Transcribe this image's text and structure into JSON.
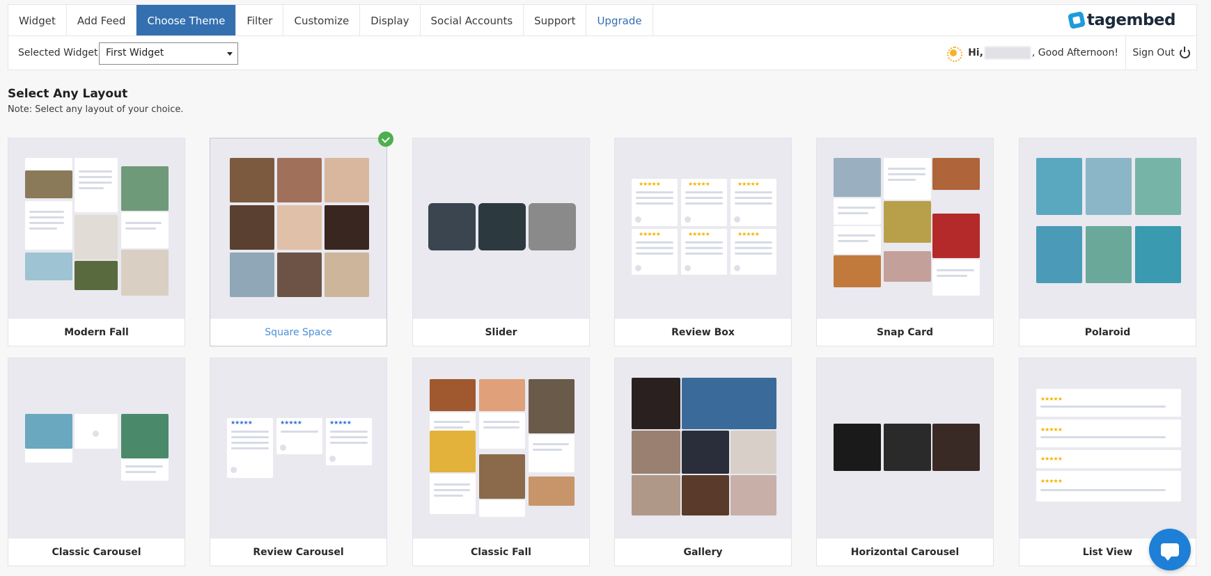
{
  "nav": {
    "tabs": [
      {
        "label": "Widget"
      },
      {
        "label": "Add Feed"
      },
      {
        "label": "Choose Theme"
      },
      {
        "label": "Filter"
      },
      {
        "label": "Customize"
      },
      {
        "label": "Display"
      },
      {
        "label": "Social Accounts"
      },
      {
        "label": "Support"
      },
      {
        "label": "Upgrade"
      }
    ],
    "active_tab": "Choose Theme",
    "logo_text": "tagembed"
  },
  "widget_bar": {
    "label": "Selected Widget",
    "selected_value": "First Widget",
    "greeting_prefix": "Hi,",
    "greeting_suffix": ", Good Afternoon!",
    "signout_label": "Sign Out"
  },
  "page": {
    "title": "Select Any Layout",
    "note": "Note: Select any layout of your choice."
  },
  "layouts": [
    {
      "name": "Modern Fall",
      "selected": false
    },
    {
      "name": "Square Space",
      "selected": true
    },
    {
      "name": "Slider",
      "selected": false
    },
    {
      "name": "Review Box",
      "selected": false
    },
    {
      "name": "Snap Card",
      "selected": false
    },
    {
      "name": "Polaroid",
      "selected": false
    },
    {
      "name": "Classic Carousel",
      "selected": false
    },
    {
      "name": "Review Carousel",
      "selected": false
    },
    {
      "name": "Classic Fall",
      "selected": false
    },
    {
      "name": "Gallery",
      "selected": false
    },
    {
      "name": "Horizontal Carousel",
      "selected": false
    },
    {
      "name": "List View",
      "selected": false
    }
  ],
  "colors": {
    "accent": "#3470b0",
    "selected_label": "#4a90d9",
    "check": "#4caf50",
    "chat": "#1e7fd6"
  }
}
